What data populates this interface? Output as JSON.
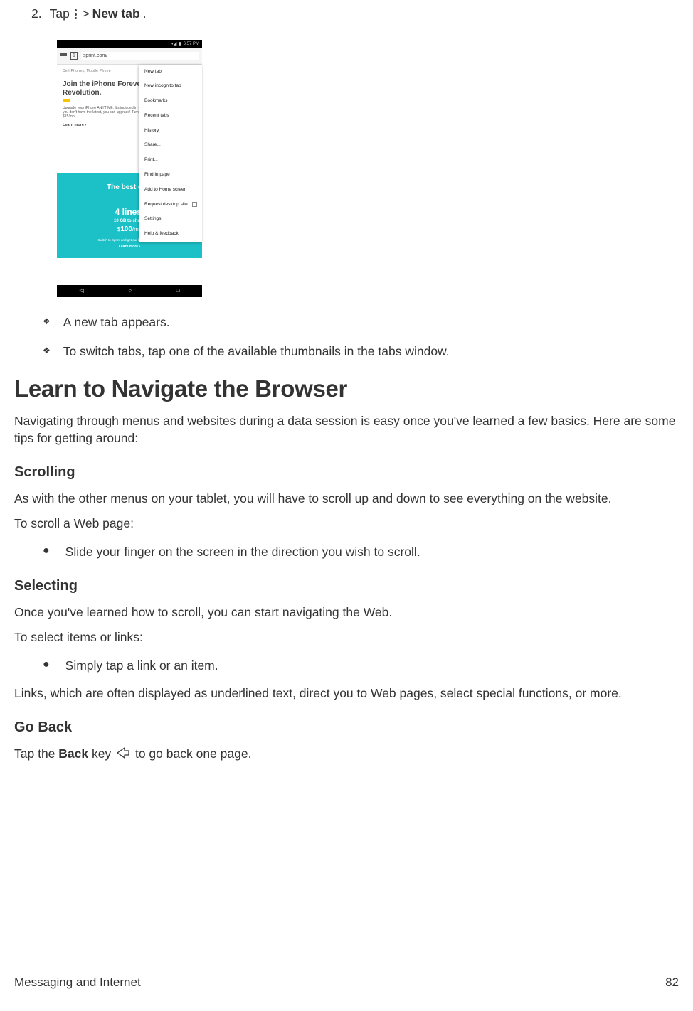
{
  "step": {
    "num": "2.",
    "tap": "Tap",
    "gt": ">",
    "bold": "New tab",
    "period": "."
  },
  "screenshot": {
    "status_time": "6:57 PM",
    "tabcount": "1",
    "url": "sprint.com/",
    "search_hint": "Cell Phones, Mobile Phone",
    "headline1": "Join the iPhone Forever",
    "headline2": "Revolution.",
    "para": "Upgrade your iPhone ANYTIME. It's included in your monthly rate – $22/mo. Anytime you don't have the latest, you can upgrade! Turn in a smartphone now and get it for $15/mo!",
    "learnmore": "Learn more ›",
    "bestdeal": "The best deal",
    "fourlines": "4 lines.",
    "share": "10 GB to share.",
    "price_s": "$",
    "price_n": "100",
    "price_per": "/mo",
    "switch": "Switch to Sprint and get our best family plan.",
    "lm2": "Learn more ›",
    "menu": {
      "m0": "New tab",
      "m1": "New incognito tab",
      "m2": "Bookmarks",
      "m3": "Recent tabs",
      "m4": "History",
      "m5": "Share...",
      "m6": "Print...",
      "m7": "Find in page",
      "m8": "Add to Home screen",
      "m9": "Request desktop site",
      "m10": "Settings",
      "m11": "Help & feedback"
    }
  },
  "bullets": {
    "b1": "A new tab appears.",
    "b2": "To switch tabs, tap one of the available thumbnails in the tabs window."
  },
  "h1": "Learn to Navigate the Browser",
  "intro": "Navigating through menus and websites during a data session is easy once you've learned a few basics. Here are some tips for getting around:",
  "scrolling": {
    "h": "Scrolling",
    "p1": "As with the other menus on your tablet, you will have to scroll up and down to see everything on the website.",
    "p2": "To scroll a Web page:",
    "b1": "Slide your finger on the screen in the direction you wish to scroll."
  },
  "selecting": {
    "h": "Selecting",
    "p1": "Once you've learned how to scroll, you can start navigating the Web.",
    "p2": "To select items or links:",
    "b1": "Simply tap a link or an item.",
    "p3": "Links, which are often displayed as underlined text, direct you to Web pages, select special functions, or more."
  },
  "goback": {
    "h": "Go Back",
    "pre": "Tap the ",
    "bold": "Back",
    "mid": " key ",
    "post": " to go back one page."
  },
  "footer": {
    "left": "Messaging and Internet",
    "right": "82"
  }
}
